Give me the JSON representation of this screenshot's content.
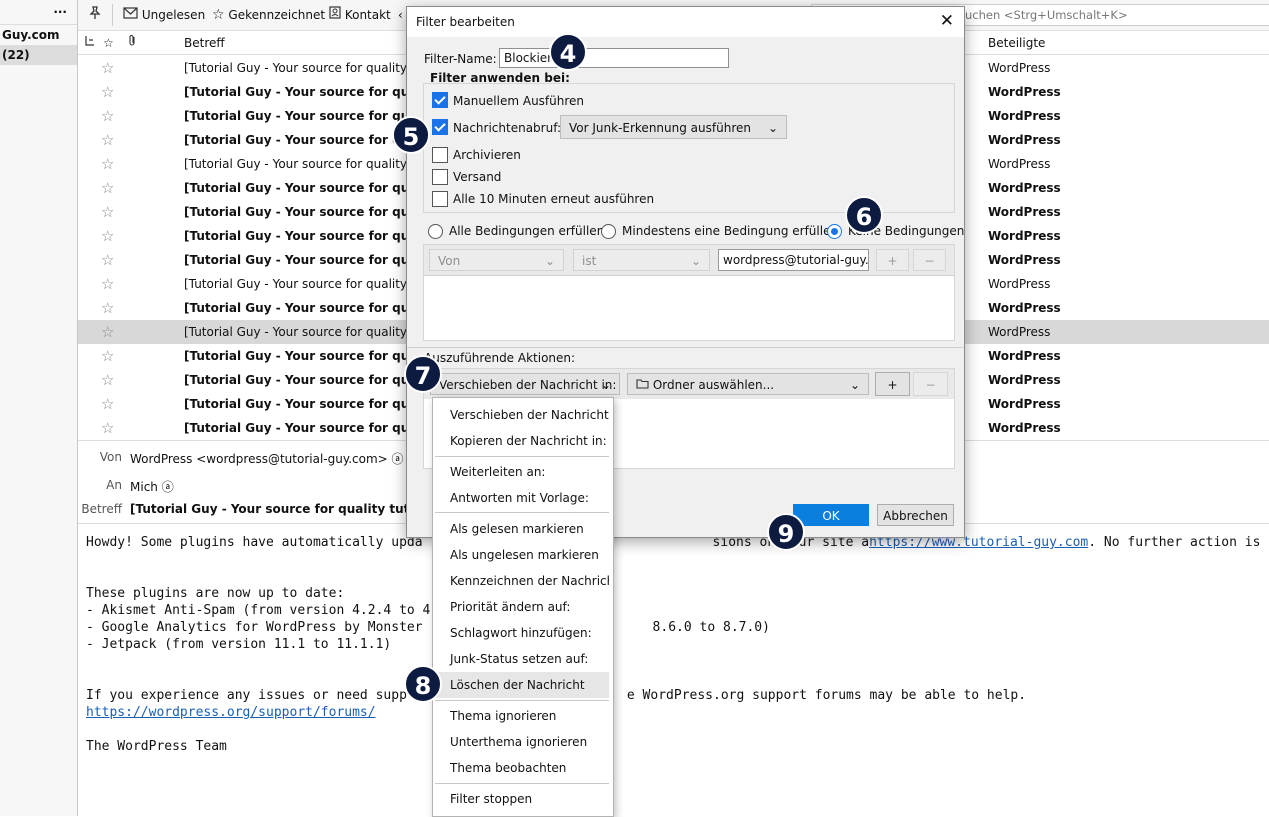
{
  "folders": {
    "menu_dots": "...",
    "items": [
      {
        "label": "Guy.com"
      },
      {
        "label": "(22)"
      }
    ]
  },
  "toolbar": {
    "unread": "Ungelesen",
    "starred": "Gekennzeichnet",
    "contact": "Kontakt",
    "search_placeholder": "suchen <Strg+Umschalt+K>"
  },
  "list": {
    "col_subject": "Betreff",
    "col_participants": "Beteiligte",
    "rows": [
      {
        "subject": "[Tutorial Guy - Your source for quality tutorials!]",
        "participants": "WordPress"
      },
      {
        "subject": "[Tutorial Guy - Your source for quality tutorials!]",
        "participants": "WordPress"
      },
      {
        "subject": "[Tutorial Guy - Your source for quality tutorials!]",
        "participants": "WordPress"
      },
      {
        "subject": "[Tutorial Guy - Your source for quality tutorials!]",
        "participants": "WordPress"
      },
      {
        "subject": "[Tutorial Guy - Your source for quality tutorials!]",
        "participants": "WordPress"
      },
      {
        "subject": "[Tutorial Guy - Your source for quality tutorials!]",
        "participants": "WordPress"
      },
      {
        "subject": "[Tutorial Guy - Your source for quality tutorials!]",
        "participants": "WordPress"
      },
      {
        "subject": "[Tutorial Guy - Your source for quality tutorials!]",
        "participants": "WordPress"
      },
      {
        "subject": "[Tutorial Guy - Your source for quality tutorials!]",
        "participants": "WordPress"
      },
      {
        "subject": "[Tutorial Guy - Your source for quality tutorials!]",
        "participants": "WordPress"
      },
      {
        "subject": "[Tutorial Guy - Your source for quality tutorials!]",
        "participants": "WordPress"
      },
      {
        "subject": "[Tutorial Guy - Your source for quality tutorials!]",
        "participants": "WordPress"
      },
      {
        "subject": "[Tutorial Guy - Your source for quality tutorials!]",
        "participants": "WordPress"
      },
      {
        "subject": "[Tutorial Guy - Your source for quality tutorials!]",
        "participants": "WordPress"
      },
      {
        "subject": "[Tutorial Guy - Your source for quality tutorials!]",
        "participants": "WordPress"
      },
      {
        "subject": "[Tutorial Guy - Your source for quality tutorials!]",
        "participants": "WordPress"
      }
    ]
  },
  "message": {
    "from_label": "Von",
    "from_value": "WordPress <wordpress@tutorial-guy.com>",
    "to_label": "An",
    "to_value": "Mich",
    "subject_label": "Betreff",
    "subject_value": "[Tutorial Guy - Your source for quality tutorials!] So",
    "body": {
      "line1a": "Howdy! Some plugins have automatically upda",
      "line1b": "sions on your site a",
      "line1_link": "https://www.tutorial-guy.com",
      "line1c": ". No further action is needed on",
      "line2": "These plugins are now up to date:",
      "line3": "- Akismet Anti-Spam (from version 4.2.4 to 4",
      "line4a": "- Google Analytics for WordPress by Monster",
      "line4b": "8.6.0 to 8.7.0)",
      "line5": "- Jetpack (from version 11.1 to 11.1.1)",
      "line6a": "If you experience any issues or need supp",
      "line6b": "e WordPress.org support forums may be able to help.",
      "line7_link": "https://wordpress.org/support/forums/",
      "line8": "The WordPress Team"
    }
  },
  "dialog": {
    "title": "Filter bearbeiten",
    "close": "✕",
    "filter_name_label": "Filter-Name:",
    "filter_name_value": "Blockiert",
    "apply_on_label": "Filter anwenden bei:",
    "manual": "Manuellem Ausführen",
    "fetch": "Nachrichtenabruf:",
    "fetch_option": "Vor Junk-Erkennung ausführen",
    "archive": "Archivieren",
    "send": "Versand",
    "periodic": "Alle 10 Minuten erneut ausführen",
    "match_all": "Alle Bedingungen erfüllen",
    "match_any": "Mindestens eine Bedingung erfüllen",
    "match_none": "Keine Bedingungen",
    "cond_field": "Von",
    "cond_op": "ist",
    "cond_value": "wordpress@tutorial-guy.co",
    "plus": "+",
    "minus": "−",
    "actions_label": "Auszuführende Aktionen:",
    "action_select": "Verschieben der Nachricht in:",
    "folder_select": "Ordner auswählen...",
    "ok": "OK",
    "cancel": "Abbrechen"
  },
  "menu": {
    "items": [
      "Verschieben der Nachricht ...",
      "Kopieren der Nachricht in:",
      "Weiterleiten an:",
      "Antworten mit Vorlage:",
      "Als gelesen markieren",
      "Als ungelesen markieren",
      "Kennzeichnen der Nachricht",
      "Priorität ändern auf:",
      "Schlagwort hinzufügen:",
      "Junk-Status setzen auf:",
      "Löschen der Nachricht",
      "Thema ignorieren",
      "Unterthema ignorieren",
      "Thema beobachten",
      "Filter stoppen"
    ]
  },
  "badges": [
    "4",
    "5",
    "6",
    "7",
    "8",
    "9"
  ]
}
